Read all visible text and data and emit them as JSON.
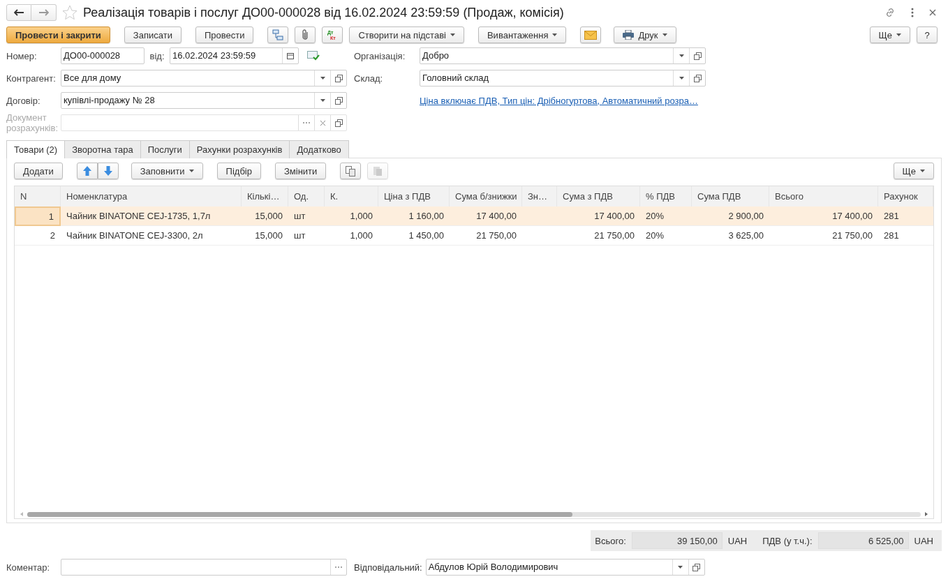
{
  "window": {
    "title": "Реалізація товарів і послуг ДО00-000028 від 16.02.2024 23:59:59 (Продаж, комісія)"
  },
  "toolbar": [
    {
      "kind": "primary",
      "label": "Провести і закрити"
    },
    {
      "kind": "text",
      "label": "Записати"
    },
    {
      "kind": "text",
      "label": "Провести"
    },
    {
      "kind": "structure"
    },
    {
      "kind": "attach"
    },
    {
      "kind": "dtkt",
      "label": "Дт",
      "sublabel": "Кт"
    },
    {
      "kind": "menu",
      "label": "Створити на підставі"
    },
    {
      "kind": "menu",
      "label": "Вивантаження"
    },
    {
      "kind": "mail"
    },
    {
      "kind": "print",
      "label": "Друк"
    }
  ],
  "toolbar_right": [
    {
      "kind": "menu",
      "label": "Ще"
    },
    {
      "kind": "text",
      "label": "?"
    }
  ],
  "header": {
    "number_label": "Номер:",
    "number": "ДО00-000028",
    "date_label": "від:",
    "date": "16.02.2024 23:59:59",
    "left": [
      {
        "label": "Контрагент:",
        "value": "Все для дому",
        "disabled": false
      },
      {
        "label": "Договір:",
        "value": "купівлі-продажу № 28",
        "disabled": false
      },
      {
        "label": "Документ розрахунків:",
        "disabled": true
      }
    ],
    "right": [
      {
        "label": "Організація:",
        "value": "Добро"
      },
      {
        "label": "Склад:",
        "value": "Головний склад"
      }
    ],
    "price_link": "Ціна включає ПДВ, Тип цін: Дрібногуртова, Автоматичний розра…"
  },
  "tabs": [
    {
      "label": "Товари (2)",
      "selected": true
    },
    {
      "label": "Зворотна тара",
      "selected": false
    },
    {
      "label": "Послуги",
      "selected": false
    },
    {
      "label": "Рахунки розрахунків",
      "selected": false
    },
    {
      "label": "Додатково",
      "selected": false
    }
  ],
  "table_toolbar": [
    {
      "kind": "text",
      "label": "Додати"
    },
    {
      "kind": "up"
    },
    {
      "kind": "down"
    },
    {
      "kind": "menu",
      "label": "Заповнити"
    },
    {
      "kind": "text",
      "label": "Підбір"
    },
    {
      "kind": "text",
      "label": "Змінити"
    },
    {
      "kind": "copy",
      "disabled": false
    },
    {
      "kind": "paste",
      "disabled": true
    }
  ],
  "table_more": "Ще",
  "table": {
    "columns": [
      {
        "label": "N",
        "kind": "number"
      },
      {
        "label": "Номенклатура",
        "kind": "text"
      },
      {
        "label": "Кількі…",
        "kind": "number"
      },
      {
        "label": "Од.",
        "kind": "text"
      },
      {
        "label": "К.",
        "kind": "number"
      },
      {
        "label": "Ціна з ПДВ",
        "kind": "number"
      },
      {
        "label": "Сума б/знижки",
        "kind": "number"
      },
      {
        "label": "Зн…",
        "kind": "number"
      },
      {
        "label": "Сума з ПДВ",
        "kind": "number"
      },
      {
        "label": "% ПДВ",
        "kind": "text"
      },
      {
        "label": "Сума ПДВ",
        "kind": "number"
      },
      {
        "label": "Всього",
        "kind": "number"
      },
      {
        "label": "Рахунок",
        "kind": "text"
      }
    ],
    "rows": [
      {
        "selected": true,
        "cells": [
          "1",
          "Чайник BINATONE CEJ-1735,  1,7л",
          "15,000",
          "шт",
          "1,000",
          "1 160,00",
          "17 400,00",
          "",
          "17 400,00",
          "20%",
          "2 900,00",
          "17 400,00",
          "281"
        ]
      },
      {
        "selected": false,
        "cells": [
          "2",
          "Чайник BINATONE CEJ-3300,  2л",
          "15,000",
          "шт",
          "1,000",
          "1 450,00",
          "21 750,00",
          "",
          "21 750,00",
          "20%",
          "3 625,00",
          "21 750,00",
          "281"
        ]
      }
    ]
  },
  "totals": [
    {
      "label": "Всього:",
      "value": "39 150,00",
      "currency": "UAH"
    },
    {
      "label": "ПДВ (у т.ч.):",
      "value": "6 525,00",
      "currency": "UAH"
    }
  ],
  "footer": {
    "comment_label": "Коментар:",
    "responsible_label": "Відповідальний:",
    "responsible": "Абдулов Юрій Володимирович"
  }
}
